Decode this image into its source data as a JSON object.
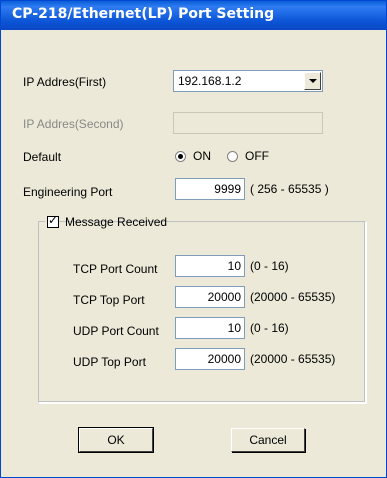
{
  "window": {
    "title": "CP-218/Ethernet(LP) Port Setting"
  },
  "ip_first": {
    "label": "IP Addres(First)",
    "value": "192.168.1.2"
  },
  "ip_second": {
    "label": "IP Addres(Second)",
    "value": ""
  },
  "default_setting": {
    "label": "Default",
    "on_label": "ON",
    "off_label": "OFF",
    "selected": "ON"
  },
  "engineering_port": {
    "label": "Engineering Port",
    "value": "9999",
    "range": "( 256 - 65535 )"
  },
  "message_received": {
    "label": "Message Received",
    "checked": true,
    "check_glyph": "✓",
    "tcp_port_count": {
      "label": "TCP Port Count",
      "value": "10",
      "range": "(0 - 16)"
    },
    "tcp_top_port": {
      "label": "TCP Top Port",
      "value": "20000",
      "range": "(20000 - 65535)"
    },
    "udp_port_count": {
      "label": "UDP Port Count",
      "value": "10",
      "range": "(0 - 16)"
    },
    "udp_top_port": {
      "label": "UDP Top Port",
      "value": "20000",
      "range": "(20000 - 65535)"
    }
  },
  "buttons": {
    "ok": "OK",
    "cancel": "Cancel"
  }
}
